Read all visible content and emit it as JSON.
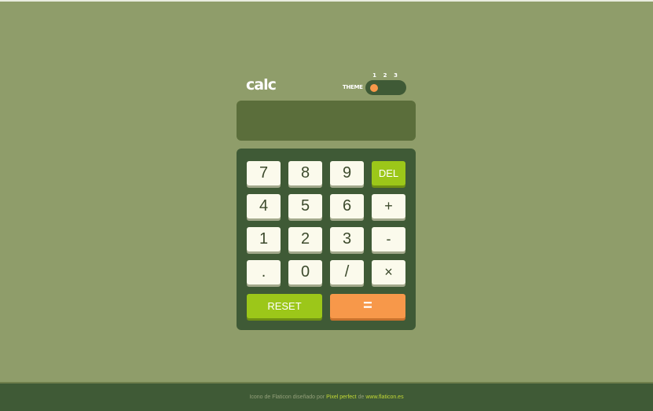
{
  "header": {
    "title": "calc",
    "theme_label": "THEME",
    "theme_options": [
      "1",
      "2",
      "3"
    ],
    "selected_theme": 1
  },
  "display": {
    "value": ""
  },
  "keys": {
    "k7": "7",
    "k8": "8",
    "k9": "9",
    "del": "DEL",
    "k4": "4",
    "k5": "5",
    "k6": "6",
    "plus": "+",
    "k1": "1",
    "k2": "2",
    "k3": "3",
    "minus": "-",
    "dot": ".",
    "k0": "0",
    "divide": "/",
    "multiply": "×",
    "reset": "RESET",
    "equals": "="
  },
  "footer": {
    "text_prefix": "Icono de Flaticon diseñado por",
    "author": "Pixel perfect",
    "text_middle": "de",
    "site": "www.flaticon.es"
  },
  "colors": {
    "page_background": "#8f9d6a",
    "keypad_background": "#3f5a36",
    "screen_background": "#5b6e3b",
    "key_background": "#fbfaec",
    "accent_green": "#9cc719",
    "accent_orange": "#f7984a"
  }
}
